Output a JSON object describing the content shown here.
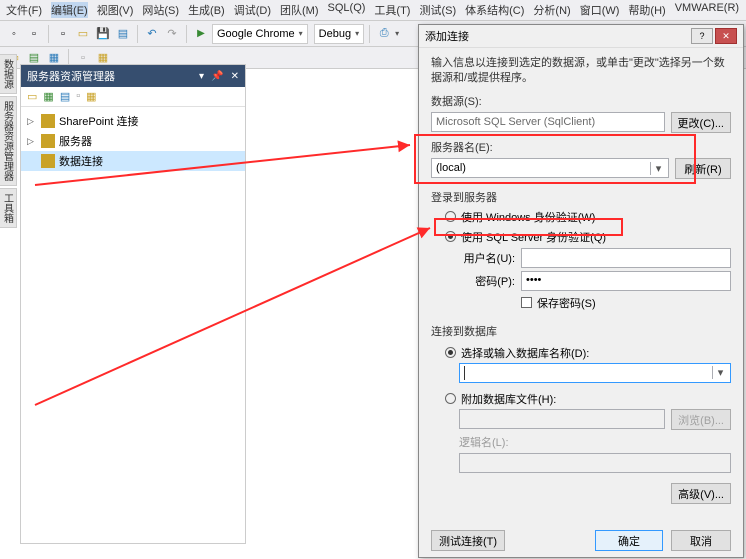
{
  "menu": [
    "文件(F)",
    "编辑(E)",
    "视图(V)",
    "网站(S)",
    "生成(B)",
    "调试(D)",
    "团队(M)",
    "SQL(Q)",
    "工具(T)",
    "测试(S)",
    "体系结构(C)",
    "分析(N)",
    "窗口(W)",
    "帮助(H)",
    "VMWARE(R)"
  ],
  "toolbar": {
    "browser": "Google Chrome",
    "config": "Debug"
  },
  "explorer": {
    "title": "服务器资源管理器",
    "items": [
      {
        "icon": "sharepoint-icon",
        "label": "SharePoint 连接",
        "exp": true
      },
      {
        "icon": "server-icon",
        "label": "服务器",
        "exp": true
      },
      {
        "icon": "db-icon",
        "label": "数据连接",
        "sel": true
      }
    ]
  },
  "vtabs": [
    "数据源",
    "服务器资源管理器",
    "工具箱"
  ],
  "dialog": {
    "title": "添加连接",
    "help_hint": "?",
    "note": "输入信息以连接到选定的数据源，或单击\"更改\"选择另一个数据源和/或提供程序。",
    "datasource_lbl": "数据源(S):",
    "datasource_val": "Microsoft SQL Server (SqlClient)",
    "change_btn": "更改(C)...",
    "server_lbl": "服务器名(E):",
    "server_val": "(local)",
    "refresh_btn": "刷新(R)",
    "login_section": "登录到服务器",
    "auth_win": "使用 Windows 身份验证(W)",
    "auth_sql": "使用 SQL Server 身份验证(Q)",
    "user_lbl": "用户名(U):",
    "user_val": "",
    "pass_lbl": "密码(P):",
    "pass_val": "••••",
    "save_pw": "保存密码(S)",
    "db_section": "连接到数据库",
    "db_radio1": "选择或输入数据库名称(D):",
    "db_radio2": "附加数据库文件(H):",
    "browse_btn": "浏览(B)...",
    "logical_lbl": "逻辑名(L):",
    "adv_btn": "高级(V)...",
    "test_btn": "测试连接(T)",
    "ok_btn": "确定",
    "cancel_btn": "取消"
  }
}
